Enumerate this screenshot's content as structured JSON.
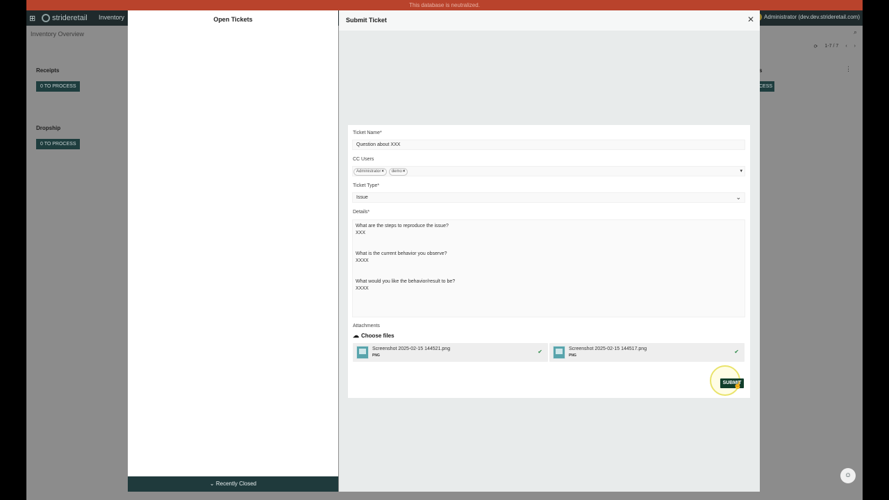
{
  "banner": {
    "text": "This database is neutralized."
  },
  "topbar": {
    "brand": "strideretail",
    "module": "Inventory",
    "user_initial": "A",
    "user": "Administrator (dev.dev.strideretail.com)"
  },
  "background": {
    "page_title": "Inventory Overview",
    "pager": "1-7 / 7",
    "cards": [
      {
        "title": "Receipts",
        "button": "0 TO PROCESS"
      },
      {
        "title": "Dropship",
        "button": "0 TO PROCESS"
      },
      {
        "title_fragment": "s",
        "button_fragment": "CESS"
      }
    ]
  },
  "left_panel": {
    "title": "Open Tickets",
    "recently_closed": "Recently Closed"
  },
  "right_panel": {
    "title": "Submit Ticket"
  },
  "form": {
    "ticket_name_label": "Ticket Name*",
    "ticket_name_value": "Question about XXX",
    "cc_users_label": "CC Users",
    "cc_users": [
      "Administrator",
      "demo"
    ],
    "ticket_type_label": "Ticket Type*",
    "ticket_type_value": "Issue",
    "details_label": "Details*",
    "details": [
      {
        "q": "What are the steps to reproduce the issue?",
        "a": "XXX"
      },
      {
        "q": "What is the current behavior you observe?",
        "a": "XXXX"
      },
      {
        "q": "What would you like the behavior/result to be?",
        "a": "XXXX"
      }
    ],
    "attachments_label": "Attachments",
    "choose_files": "Choose files",
    "files": [
      {
        "name": "Screenshot 2025-02-15 144521.png",
        "type": "PNG"
      },
      {
        "name": "Screenshot 2025-02-15 144517.png",
        "type": "PNG"
      }
    ],
    "submit_label": "SUBMIT"
  },
  "colors": {
    "banner": "#b9432c",
    "topbar": "#1f2a2c",
    "primary_dark": "#1f3a3c",
    "submit": "#113e2a",
    "check": "#2f8a4a"
  }
}
